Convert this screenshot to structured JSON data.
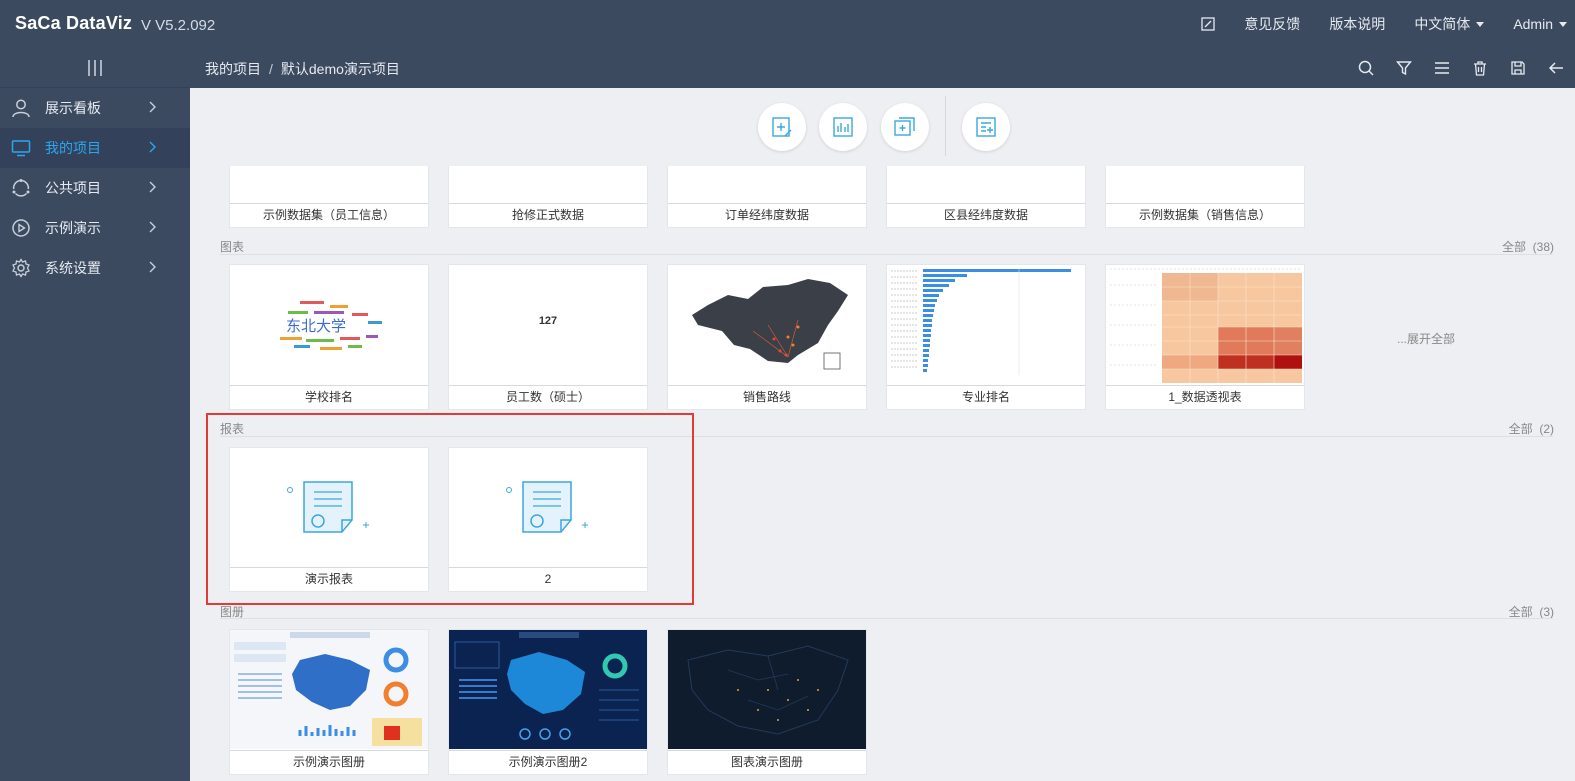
{
  "app": {
    "logo": "SaCa DataViz",
    "version": "V V5.2.092"
  },
  "topnav": {
    "feedback": "意见反馈",
    "release_notes": "版本说明",
    "language": "中文简体",
    "user": "Admin"
  },
  "breadcrumb": {
    "root": "我的项目",
    "separator": "/",
    "current": "默认demo演示项目"
  },
  "sidebar": {
    "items": [
      {
        "label": "展示看板",
        "icon": "user-icon",
        "active": false
      },
      {
        "label": "我的项目",
        "icon": "monitor-icon",
        "active": true
      },
      {
        "label": "公共项目",
        "icon": "share-circle-icon",
        "active": false
      },
      {
        "label": "示例演示",
        "icon": "play-circle-icon",
        "active": false
      },
      {
        "label": "系统设置",
        "icon": "gear-icon",
        "active": false
      }
    ]
  },
  "sections": {
    "datasets": {
      "cards": [
        "示例数据集（员工信息）",
        "抢修正式数据",
        "订单经纬度数据",
        "区县经纬度数据",
        "示例数据集（销售信息）"
      ]
    },
    "charts": {
      "title": "图表",
      "count_label": "全部",
      "count": "(38)",
      "cards": [
        "学校排名",
        "员工数（硕士）",
        "销售路线",
        "专业排名",
        "1_数据透视表"
      ],
      "number_preview": "127",
      "wordcloud_text": "东北大学",
      "expand_all": "...展开全部"
    },
    "reports": {
      "title": "报表",
      "count_label": "全部",
      "count": "(2)",
      "cards": [
        "演示报表",
        "2"
      ]
    },
    "albums": {
      "title": "图册",
      "count_label": "全部",
      "count": "(3)",
      "cards": [
        "示例演示图册",
        "示例演示图册2",
        "图表演示图册"
      ]
    }
  },
  "colors": {
    "header_bg": "#3c4a60",
    "active_text": "#2aa7f0",
    "highlight_border": "#e53935",
    "report_icon": "#3aa8de"
  }
}
